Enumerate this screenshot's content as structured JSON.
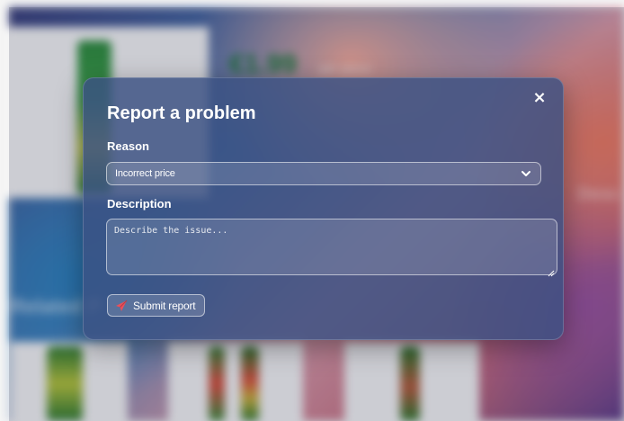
{
  "background": {
    "price": "€1.99",
    "price_unit": "per piece",
    "section_heading": "Related P",
    "side_text": "Desc"
  },
  "modal": {
    "title": "Report a problem",
    "close_label": "×",
    "reason": {
      "label": "Reason",
      "selected": "Incorrect price",
      "icon": "chevron-down-icon"
    },
    "description": {
      "label": "Description",
      "placeholder": "Describe the issue...",
      "value": ""
    },
    "submit": {
      "label": "Submit report",
      "icon": "send-icon",
      "icon_color": "#e8505b"
    }
  },
  "colors": {
    "modal_bg": "#3a5082",
    "text": "#ffffff",
    "accent": "#e8505b"
  }
}
